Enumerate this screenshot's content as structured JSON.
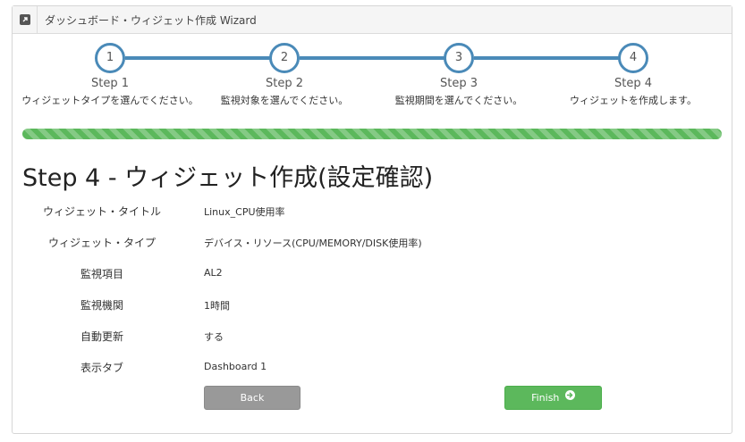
{
  "header": {
    "title": "ダッシュボード・ウィジェット作成 Wizard",
    "icon": "external-link-icon"
  },
  "steps": [
    {
      "number": "1",
      "name": "Step 1",
      "description": "ウィジェットタイプを選んでください。"
    },
    {
      "number": "2",
      "name": "Step 2",
      "description": "監視対象を選んでください。"
    },
    {
      "number": "3",
      "name": "Step 3",
      "description": "監視期間を選んでください。"
    },
    {
      "number": "4",
      "name": "Step 4",
      "description": "ウィジェットを作成します。"
    }
  ],
  "progress": {
    "percent": 100,
    "color": "#5cb85c"
  },
  "main": {
    "title": "Step 4 - ウィジェット作成(設定確認)",
    "fields": [
      {
        "label": "ウィジェット・タイトル",
        "value": "Linux_CPU使用率"
      },
      {
        "label": "ウィジェット・タイプ",
        "value": "デバイス・リソース(CPU/MEMORY/DISK使用率)"
      },
      {
        "label": "監視項目",
        "value": "AL2"
      },
      {
        "label": "監視機関",
        "value": "1時間"
      },
      {
        "label": "自動更新",
        "value": "する"
      },
      {
        "label": "表示タブ",
        "value": "Dashboard 1"
      }
    ]
  },
  "buttons": {
    "back_label": "Back",
    "finish_label": "Finish",
    "finish_icon": "arrow-circle-right-icon"
  },
  "colors": {
    "accent": "#4a8ab8",
    "success": "#5cb85c",
    "secondary": "#999999"
  }
}
